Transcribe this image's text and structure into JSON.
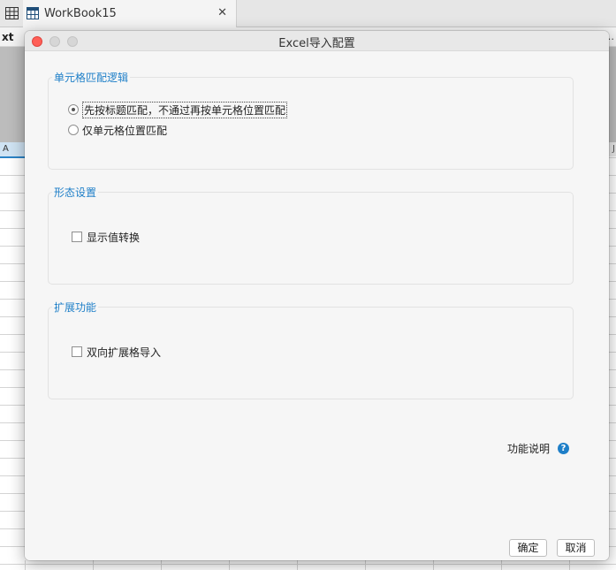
{
  "workbook_tab": {
    "name": "WorkBook15",
    "close": "✕"
  },
  "toolbar": {
    "left_text": "xt",
    "right_text": "…"
  },
  "sheet": {
    "column_a": "A",
    "column_j": "J"
  },
  "dialog": {
    "title": "Excel导入配置",
    "groups": [
      {
        "title": "单元格匹配逻辑",
        "options": [
          {
            "label": "先按标题匹配，不通过再按单元格位置匹配",
            "checked": true
          },
          {
            "label": "仅单元格位置匹配",
            "checked": false
          }
        ]
      },
      {
        "title": "形态设置",
        "options": [
          {
            "label": "显示值转换",
            "checked": false
          }
        ]
      },
      {
        "title": "扩展功能",
        "options": [
          {
            "label": "双向扩展格导入",
            "checked": false
          }
        ]
      }
    ],
    "help_label": "功能说明",
    "help_icon": "?",
    "ok_label": "确定",
    "cancel_label": "取消"
  },
  "colors": {
    "accent": "#1e7fc8",
    "close_light": "#ff5f57",
    "selected_header": "#cfe3f3"
  }
}
